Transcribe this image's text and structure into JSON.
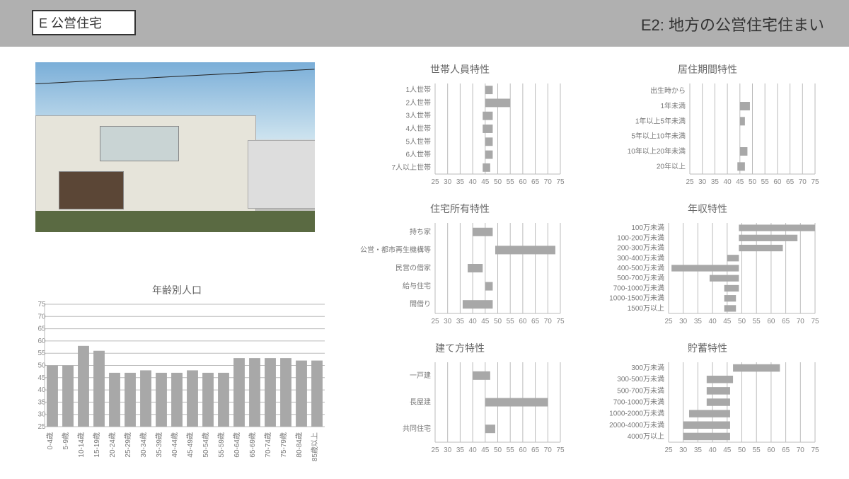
{
  "header": {
    "title_box": "E 公営住宅",
    "subtitle": "E2: 地方の公営住宅住まい"
  },
  "charts": {
    "age": {
      "title": "年齢別人口",
      "categories": [
        "0-4歳",
        "5-9歳",
        "10-14歳",
        "15-19歳",
        "20-24歳",
        "25-29歳",
        "30-34歳",
        "35-39歳",
        "40-44歳",
        "45-49歳",
        "50-54歳",
        "55-59歳",
        "60-64歳",
        "65-69歳",
        "70-74歳",
        "75-79歳",
        "80-84歳",
        "85歳以上"
      ],
      "values": [
        50,
        50,
        58,
        56,
        47,
        47,
        48,
        47,
        47,
        48,
        47,
        47,
        53,
        53,
        53,
        53,
        52,
        52
      ],
      "ylim": [
        25,
        75
      ]
    },
    "household": {
      "title": "世帯人員特性",
      "categories": [
        "1人世帯",
        "2人世帯",
        "3人世帯",
        "4人世帯",
        "5人世帯",
        "6人世帯",
        "7人以上世帯"
      ],
      "lo": [
        45,
        45,
        44,
        44,
        45,
        45,
        44
      ],
      "hi": [
        48,
        55,
        48,
        48,
        48,
        48,
        47
      ],
      "xlim": [
        25,
        75
      ]
    },
    "residence": {
      "title": "居住期間特性",
      "categories": [
        "出生時から",
        "1年未満",
        "1年以上5年未満",
        "5年以上10年未満",
        "10年以上20年未満",
        "20年以上"
      ],
      "lo": [
        null,
        45,
        45,
        null,
        45,
        44
      ],
      "hi": [
        null,
        49,
        47,
        null,
        48,
        47
      ],
      "xlim": [
        25,
        75
      ]
    },
    "ownership": {
      "title": "住宅所有特性",
      "categories": [
        "持ち家",
        "公営・都市再生機構等",
        "民営の借家",
        "給与住宅",
        "間借り"
      ],
      "lo": [
        40,
        49,
        38,
        45,
        36
      ],
      "hi": [
        48,
        73,
        44,
        48,
        48
      ],
      "xlim": [
        25,
        75
      ]
    },
    "income": {
      "title": "年収特性",
      "categories": [
        "100万未満",
        "100-200万未満",
        "200-300万未満",
        "300-400万未満",
        "400-500万未満",
        "500-700万未満",
        "700-1000万未満",
        "1000-1500万未満",
        "1500万以上"
      ],
      "lo": [
        49,
        49,
        49,
        45,
        26,
        39,
        44,
        44,
        44
      ],
      "hi": [
        75,
        69,
        64,
        49,
        49,
        49,
        49,
        48,
        48
      ],
      "xlim": [
        25,
        75
      ]
    },
    "buildtype": {
      "title": "建て方特性",
      "categories": [
        "一戸建",
        "長屋建",
        "共同住宅"
      ],
      "lo": [
        40,
        45,
        45
      ],
      "hi": [
        47,
        70,
        49
      ],
      "xlim": [
        25,
        75
      ]
    },
    "savings": {
      "title": "貯蓄特性",
      "categories": [
        "300万未満",
        "300-500万未満",
        "500-700万未満",
        "700-1000万未満",
        "1000-2000万未満",
        "2000-4000万未満",
        "4000万以上"
      ],
      "lo": [
        47,
        38,
        38,
        38,
        32,
        30,
        30
      ],
      "hi": [
        63,
        47,
        46,
        46,
        46,
        46,
        46
      ],
      "xlim": [
        25,
        75
      ]
    }
  },
  "chart_data": [
    {
      "type": "bar",
      "orientation": "vertical",
      "title": "年齢別人口",
      "categories": [
        "0-4歳",
        "5-9歳",
        "10-14歳",
        "15-19歳",
        "20-24歳",
        "25-29歳",
        "30-34歳",
        "35-39歳",
        "40-44歳",
        "45-49歳",
        "50-54歳",
        "55-59歳",
        "60-64歳",
        "65-69歳",
        "70-74歳",
        "75-79歳",
        "80-84歳",
        "85歳以上"
      ],
      "values": [
        50,
        50,
        58,
        56,
        47,
        47,
        48,
        47,
        47,
        48,
        47,
        47,
        53,
        53,
        53,
        53,
        52,
        52
      ],
      "xlabel": "",
      "ylabel": "",
      "ylim": [
        25,
        75
      ]
    },
    {
      "type": "range-bar",
      "orientation": "horizontal",
      "title": "世帯人員特性",
      "categories": [
        "1人世帯",
        "2人世帯",
        "3人世帯",
        "4人世帯",
        "5人世帯",
        "6人世帯",
        "7人以上世帯"
      ],
      "series": [
        {
          "name": "range",
          "lo": [
            45,
            45,
            44,
            44,
            45,
            45,
            44
          ],
          "hi": [
            48,
            55,
            48,
            48,
            48,
            48,
            47
          ]
        }
      ],
      "xlim": [
        25,
        75
      ]
    },
    {
      "type": "range-bar",
      "orientation": "horizontal",
      "title": "居住期間特性",
      "categories": [
        "出生時から",
        "1年未満",
        "1年以上5年未満",
        "5年以上10年未満",
        "10年以上20年未満",
        "20年以上"
      ],
      "series": [
        {
          "name": "range",
          "lo": [
            null,
            45,
            45,
            null,
            45,
            44
          ],
          "hi": [
            null,
            49,
            47,
            null,
            48,
            47
          ]
        }
      ],
      "xlim": [
        25,
        75
      ]
    },
    {
      "type": "range-bar",
      "orientation": "horizontal",
      "title": "住宅所有特性",
      "categories": [
        "持ち家",
        "公営・都市再生機構等",
        "民営の借家",
        "給与住宅",
        "間借り"
      ],
      "series": [
        {
          "name": "range",
          "lo": [
            40,
            49,
            38,
            45,
            36
          ],
          "hi": [
            48,
            73,
            44,
            48,
            48
          ]
        }
      ],
      "xlim": [
        25,
        75
      ]
    },
    {
      "type": "range-bar",
      "orientation": "horizontal",
      "title": "年収特性",
      "categories": [
        "100万未満",
        "100-200万未満",
        "200-300万未満",
        "300-400万未満",
        "400-500万未満",
        "500-700万未満",
        "700-1000万未満",
        "1000-1500万未満",
        "1500万以上"
      ],
      "series": [
        {
          "name": "range",
          "lo": [
            49,
            49,
            49,
            45,
            26,
            39,
            44,
            44,
            44
          ],
          "hi": [
            75,
            69,
            64,
            49,
            49,
            49,
            49,
            48,
            48
          ]
        }
      ],
      "xlim": [
        25,
        75
      ]
    },
    {
      "type": "range-bar",
      "orientation": "horizontal",
      "title": "建て方特性",
      "categories": [
        "一戸建",
        "長屋建",
        "共同住宅"
      ],
      "series": [
        {
          "name": "range",
          "lo": [
            40,
            45,
            45
          ],
          "hi": [
            47,
            70,
            49
          ]
        }
      ],
      "xlim": [
        25,
        75
      ]
    },
    {
      "type": "range-bar",
      "orientation": "horizontal",
      "title": "貯蓄特性",
      "categories": [
        "300万未満",
        "300-500万未満",
        "500-700万未満",
        "700-1000万未満",
        "1000-2000万未満",
        "2000-4000万未満",
        "4000万以上"
      ],
      "series": [
        {
          "name": "range",
          "lo": [
            47,
            38,
            38,
            38,
            32,
            30,
            30
          ],
          "hi": [
            63,
            47,
            46,
            46,
            46,
            46,
            46
          ]
        }
      ],
      "xlim": [
        25,
        75
      ]
    }
  ]
}
